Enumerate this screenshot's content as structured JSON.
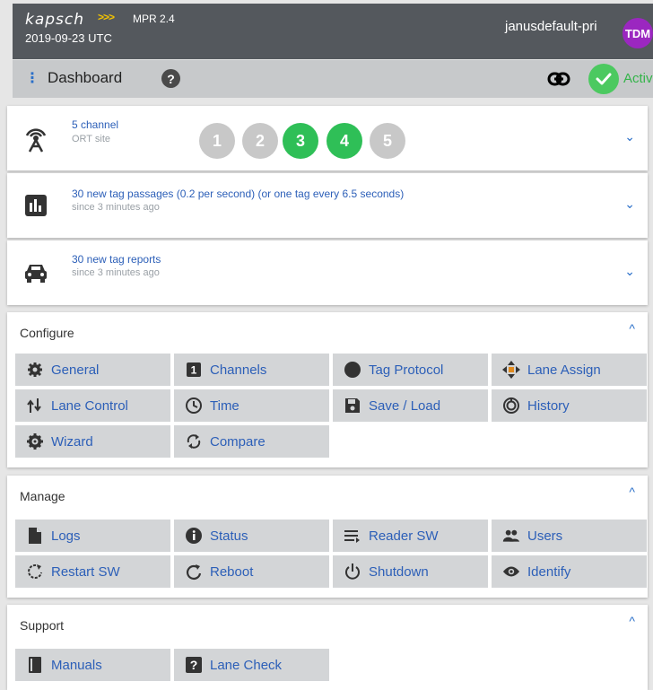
{
  "header": {
    "brand": "kapsch",
    "brand_arrows": ">>>",
    "version": "MPR 2.4",
    "datetime": "2019-09-23 UTC",
    "username": "janusdefault-pri",
    "avatar_initials": "TDM"
  },
  "dashbar": {
    "menu_glyph": "⋮",
    "title": "Dashboard",
    "help_glyph": "?",
    "status": "Active",
    "status_color": "#4cc960"
  },
  "site": {
    "title": "5 channel",
    "subtitle": "ORT site",
    "channels": [
      {
        "label": "1",
        "state": "inactive"
      },
      {
        "label": "2",
        "state": "inactive"
      },
      {
        "label": "3",
        "state": "active"
      },
      {
        "label": "4",
        "state": "active"
      },
      {
        "label": "5",
        "state": "inactive"
      }
    ],
    "colors": {
      "active": "#2fbf57",
      "inactive": "#c8c8c8"
    }
  },
  "passages": {
    "title": "30 new tag passages (0.2 per second) (or one tag every 6.5 seconds)",
    "subtitle": "since 3 minutes ago"
  },
  "reports": {
    "title": "30 new tag reports",
    "subtitle": "since 3 minutes ago"
  },
  "chevron_down": "⌄",
  "caret_up": "^",
  "configure": {
    "title": "Configure",
    "items": [
      {
        "label": "General",
        "icon": "gear-icon"
      },
      {
        "label": "Channels",
        "icon": "channel-number-icon"
      },
      {
        "label": "Tag Protocol",
        "icon": "circle-icon"
      },
      {
        "label": "Lane Assign",
        "icon": "move-arrows-icon"
      },
      {
        "label": "Lane Control",
        "icon": "lane-control-icon"
      },
      {
        "label": "Time",
        "icon": "clock-icon"
      },
      {
        "label": "Save / Load",
        "icon": "save-icon"
      },
      {
        "label": "History",
        "icon": "history-icon"
      },
      {
        "label": "Wizard",
        "icon": "wizard-gear-icon"
      },
      {
        "label": "Compare",
        "icon": "compare-arrows-icon"
      }
    ]
  },
  "manage": {
    "title": "Manage",
    "items": [
      {
        "label": "Logs",
        "icon": "document-icon"
      },
      {
        "label": "Status",
        "icon": "info-icon"
      },
      {
        "label": "Reader SW",
        "icon": "list-arrow-icon"
      },
      {
        "label": "Users",
        "icon": "users-icon"
      },
      {
        "label": "Restart SW",
        "icon": "restart-icon"
      },
      {
        "label": "Reboot",
        "icon": "reboot-icon"
      },
      {
        "label": "Shutdown",
        "icon": "power-icon"
      },
      {
        "label": "Identify",
        "icon": "eye-icon"
      }
    ]
  },
  "support": {
    "title": "Support",
    "items": [
      {
        "label": "Manuals",
        "icon": "book-icon"
      },
      {
        "label": "Lane Check",
        "icon": "question-box-icon"
      }
    ]
  }
}
